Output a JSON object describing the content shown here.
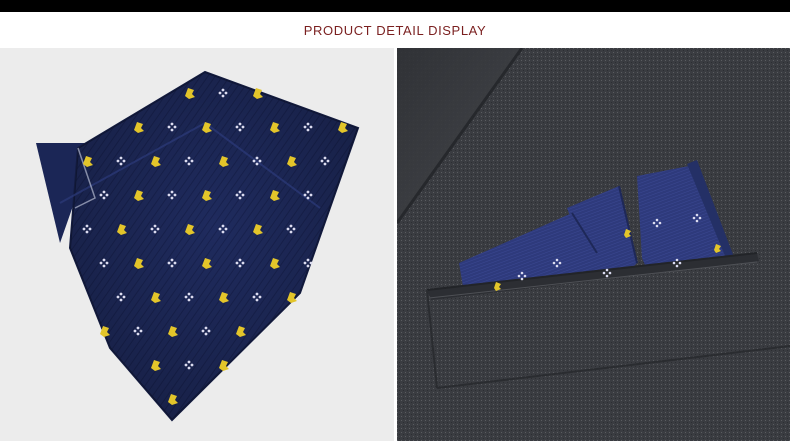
{
  "header": {
    "title": "PRODUCT DETAIL DISPLAY",
    "title_color": "#7a1f1f",
    "bar_color": "#000000"
  },
  "photos": [
    {
      "subject": "pocket-square-flat",
      "colors": {
        "fabric": "#1e2a5c",
        "dots": "#e3c52a",
        "flowers": "#dcdcf0"
      }
    },
    {
      "subject": "pocket-square-in-suit-pocket",
      "colors": {
        "suit": "#3b3d42",
        "fabric": "#2d3a78"
      }
    }
  ]
}
